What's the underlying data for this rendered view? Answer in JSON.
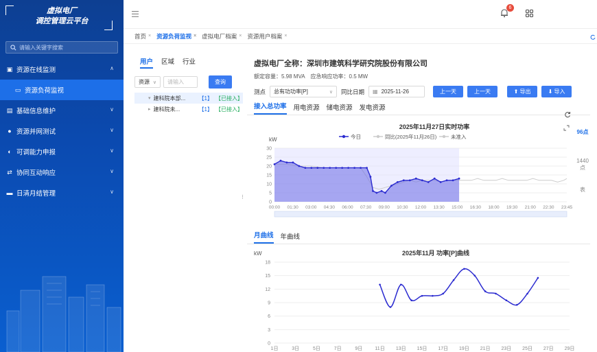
{
  "sidebar": {
    "title_line1": "虚拟电厂",
    "title_line2": "调控管理云平台",
    "search_placeholder": "请输入关键字搜索",
    "menu": [
      {
        "label": "资源在线监测",
        "icon": "▣",
        "expanded": true
      },
      {
        "label": "资源负荷监视",
        "icon": "▭",
        "sub": true
      },
      {
        "label": "基础信息维护",
        "icon": "▤"
      },
      {
        "label": "资源并网测试",
        "icon": "●"
      },
      {
        "label": "可调能力申报",
        "icon": "◐"
      },
      {
        "label": "协同互动响应",
        "icon": "⇄"
      },
      {
        "label": "日清月结管理",
        "icon": "▬"
      }
    ]
  },
  "topbar": {
    "notification_count": "6"
  },
  "tabs": [
    {
      "label": "首页",
      "active": false
    },
    {
      "label": "资源负荷监视",
      "active": true
    },
    {
      "label": "虚拟电厂档案",
      "active": false
    },
    {
      "label": "资源用户档案",
      "active": false
    }
  ],
  "left": {
    "tabs": [
      "用户",
      "区域",
      "行业"
    ],
    "filter_select": "资源",
    "filter_placeholder": "请输入",
    "query_button": "查询",
    "tree": [
      {
        "name": "建科院本部...",
        "count": "【1】",
        "status": "【已接入】"
      },
      {
        "name": "建科院未...",
        "count": "【1】",
        "status": "【已接入】"
      }
    ]
  },
  "right": {
    "title": "虚拟电厂全称：深圳市建筑科学研究院股份有限公司",
    "capacity": "额定容量：5.98 MVA",
    "response": "应急响应功率：0.5 MW",
    "metric_label": "测点",
    "metric_value": "总有功功率[P]",
    "compare_label": "同比日期",
    "compare_date": "2025-11-26",
    "btn_prev": "上一天",
    "btn_next": "上一天",
    "btn_export": "导出",
    "btn_import": "导入",
    "ctabs": [
      "接入总功率",
      "用电资源",
      "储电资源",
      "发电资源"
    ],
    "rtabs": [
      "96点",
      "1440点",
      "表"
    ],
    "mtabs": [
      "月曲线",
      "年曲线"
    ]
  },
  "chart_data": [
    {
      "type": "area",
      "title": "2025年11月27日实时功率",
      "ylabel": "kW",
      "ylim": [
        0,
        30
      ],
      "yticks": [
        0,
        5,
        10,
        15,
        20,
        25,
        30
      ],
      "xticks": [
        "00:00",
        "01:30",
        "03:00",
        "04:30",
        "06:00",
        "07:30",
        "09:00",
        "10:30",
        "12:00",
        "13:30",
        "15:00",
        "16:30",
        "18:00",
        "19:30",
        "21:00",
        "22:30",
        "23:45"
      ],
      "legend": [
        "今日",
        "同比(2025年11月26日)",
        "未准入"
      ],
      "colors": {
        "today": "#2b2bd0",
        "compare": "#cccccc"
      },
      "series": [
        {
          "name": "今日",
          "x": [
            0,
            0.5,
            1,
            1.5,
            2,
            2.5,
            3,
            3.5,
            4,
            4.5,
            5,
            5.5,
            6,
            6.5,
            7,
            7.5,
            7.8,
            8,
            8.3,
            8.7,
            9,
            9.5,
            10,
            10.5,
            11,
            11.5,
            12,
            12.5,
            13,
            13.5,
            14,
            14.5,
            15
          ],
          "y": [
            21,
            23,
            22,
            22,
            20,
            19,
            19,
            19,
            19,
            19,
            19,
            19,
            19,
            19,
            19,
            19,
            14,
            6,
            5,
            6,
            5,
            9,
            11,
            12,
            12,
            13,
            12,
            11,
            13,
            11,
            12,
            12,
            13
          ]
        },
        {
          "name": "同比(2025年11月26日)",
          "x": [
            0,
            1,
            2,
            3,
            4,
            5,
            6,
            7,
            7.5,
            8,
            8.5,
            9,
            9.5,
            10,
            10.5,
            11,
            11.5,
            12,
            12.5,
            13,
            13.5,
            14,
            14.5,
            15,
            15.5,
            16,
            16.5,
            17,
            17.5,
            18,
            18.5,
            19,
            19.5,
            20,
            20.5,
            21,
            21.5,
            22,
            22.5,
            23,
            23.5,
            23.75
          ],
          "y": [
            21,
            21,
            20,
            20,
            19,
            19,
            19,
            19,
            14,
            8,
            7,
            8,
            9,
            10,
            11,
            12,
            11,
            12,
            12,
            12,
            11,
            12,
            12,
            12,
            12,
            12,
            13,
            12,
            12,
            12,
            13,
            12,
            12,
            12,
            12,
            13,
            12,
            12,
            12,
            11,
            12,
            13
          ]
        }
      ]
    },
    {
      "type": "line",
      "title": "2025年11月 功率[P]曲线",
      "ylabel": "kW",
      "ylim": [
        0,
        18
      ],
      "yticks": [
        0,
        3,
        6,
        9,
        12,
        15,
        18
      ],
      "categories": [
        "1日",
        "3日",
        "5日",
        "7日",
        "9日",
        "11日",
        "13日",
        "15日",
        "17日",
        "19日",
        "21日",
        "23日",
        "25日",
        "27日",
        "29日"
      ],
      "series": [
        {
          "name": "功率[P]",
          "x": [
            11,
            12,
            13,
            14,
            15,
            16,
            17,
            18,
            19,
            20,
            21,
            22,
            23,
            24,
            25,
            26
          ],
          "y": [
            13,
            8,
            13,
            9.5,
            10.5,
            10.5,
            11,
            14,
            16.5,
            15,
            11.5,
            11,
            9.5,
            8.5,
            11,
            14.5
          ]
        }
      ]
    }
  ]
}
